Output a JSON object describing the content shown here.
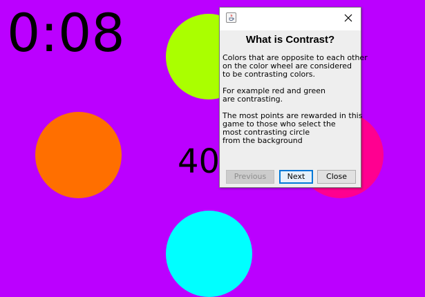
{
  "game": {
    "background": "#bb00ff",
    "timer": "0:08",
    "score": "40",
    "circles": [
      {
        "name": "green-circle",
        "color": "#aaff00"
      },
      {
        "name": "orange-circle",
        "color": "#ff6f00"
      },
      {
        "name": "pink-circle",
        "color": "#ff0090"
      },
      {
        "name": "cyan-circle",
        "color": "#00ffff"
      }
    ]
  },
  "dialog": {
    "icon": "java-icon",
    "close_icon": "close-icon",
    "heading": "What is Contrast?",
    "body_lines": [
      "Colors that are opposite to each other",
      "on the color wheel are considered",
      "to be contrasting colors.",
      "",
      "For example red and green",
      "are contrasting.",
      "",
      "The most points are rewarded in this",
      "game to those who select the",
      "most contrasting circle",
      "from the background"
    ],
    "buttons": {
      "previous": "Previous",
      "next": "Next",
      "close": "Close"
    }
  }
}
